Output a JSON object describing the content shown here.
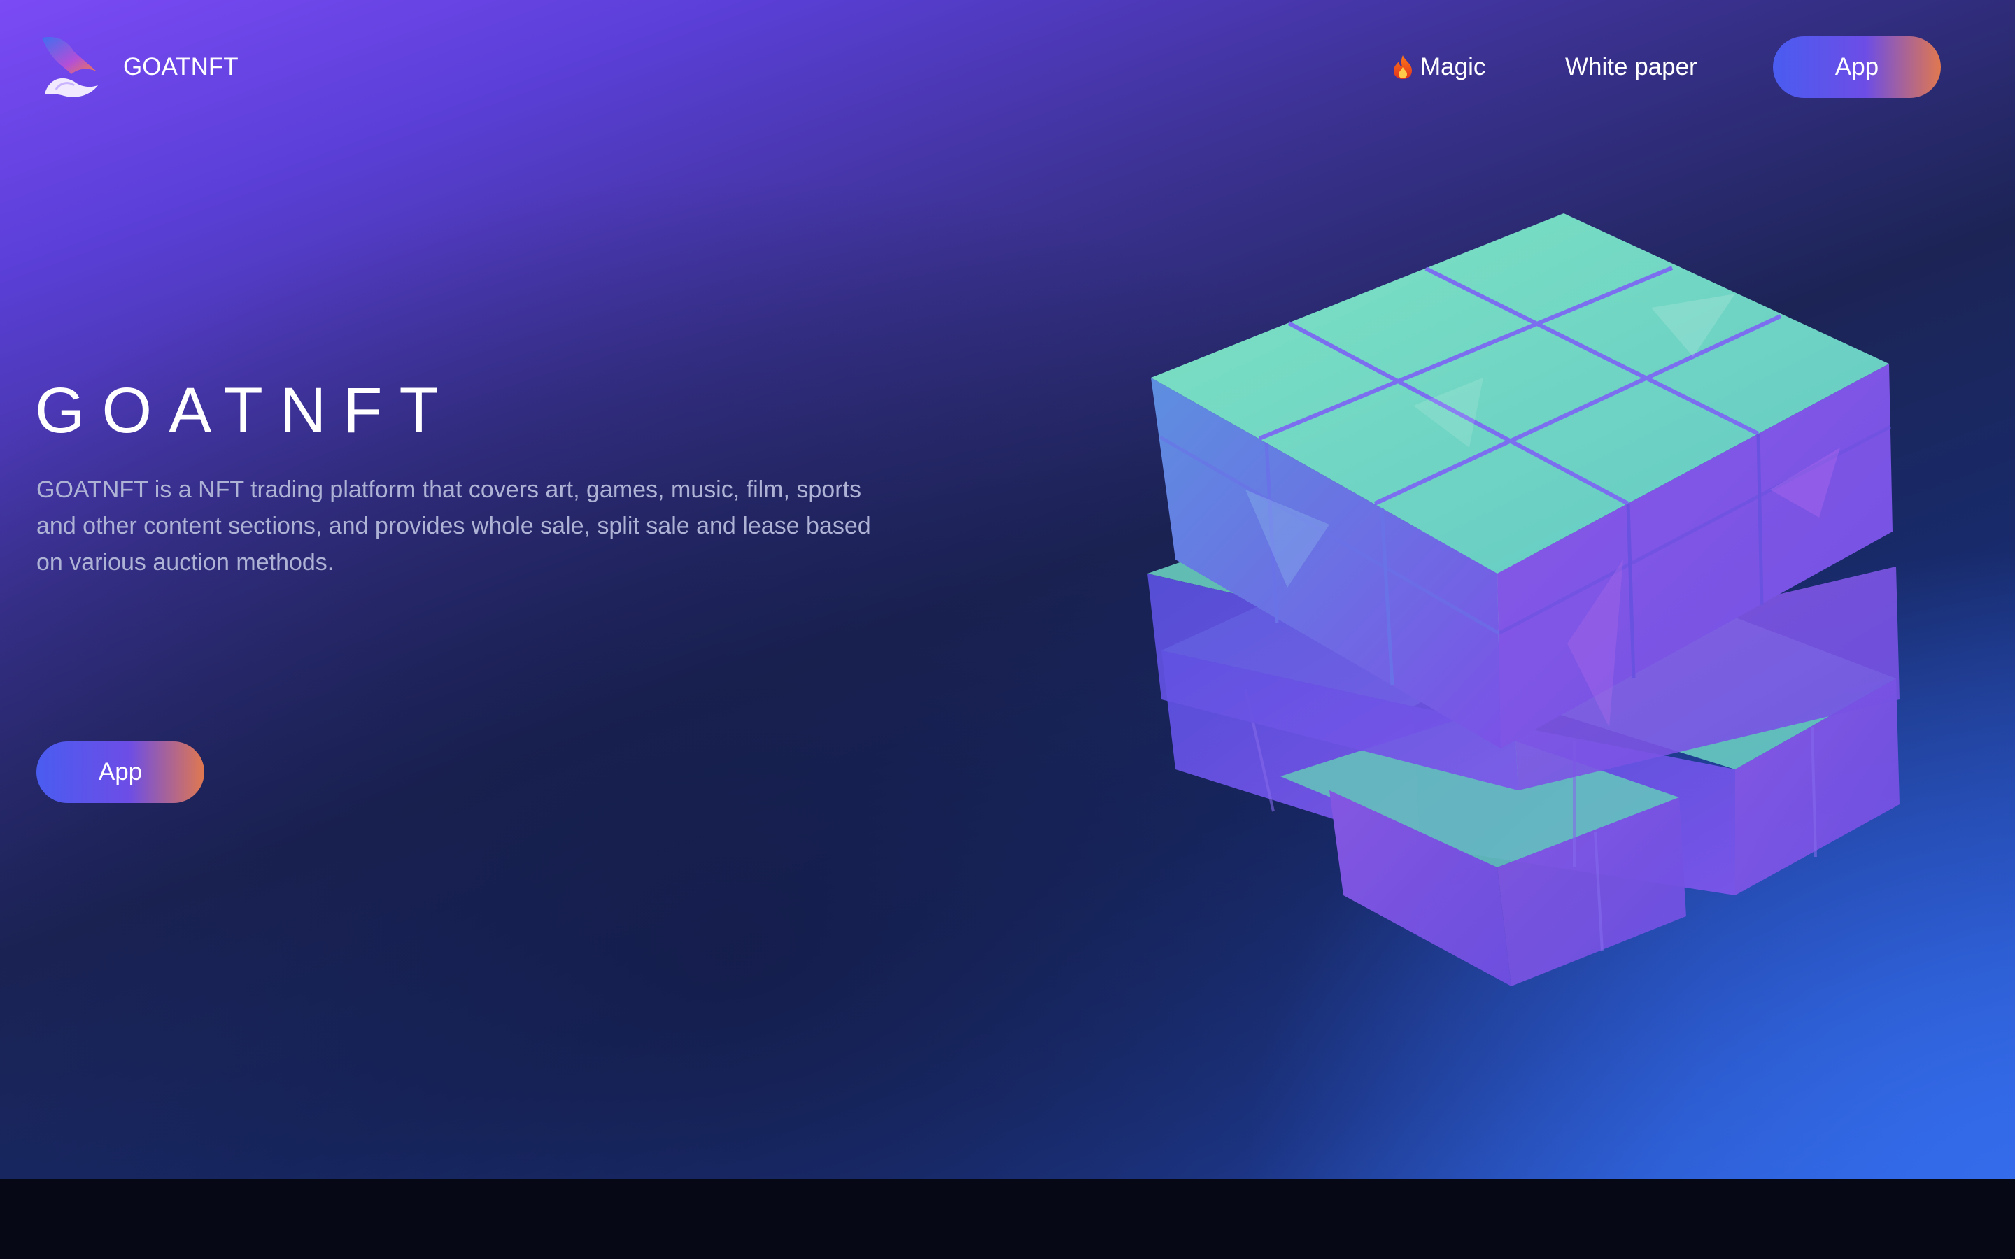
{
  "header": {
    "brand": "GOATNFT",
    "nav": {
      "magic_label": "Magic",
      "white_paper_label": "White paper"
    },
    "app_button_label": "App"
  },
  "hero": {
    "title": "GOATNFT",
    "description": "GOATNFT is a NFT trading platform that covers art, games, music, film, sports and other content sections, and provides whole sale, split sale and lease based on various auction methods.",
    "app_button_label": "App"
  },
  "icons": {
    "logo": "goat-logo-icon",
    "flame": "flame-icon",
    "cube": "rubiks-cube-illustration"
  },
  "colors": {
    "accent_gradient_start": "#4a5cf0",
    "accent_gradient_end": "#e0784f",
    "cube_top": "#6fd6bf",
    "cube_side": "#7a4fe0",
    "footer_band": "#060815"
  }
}
